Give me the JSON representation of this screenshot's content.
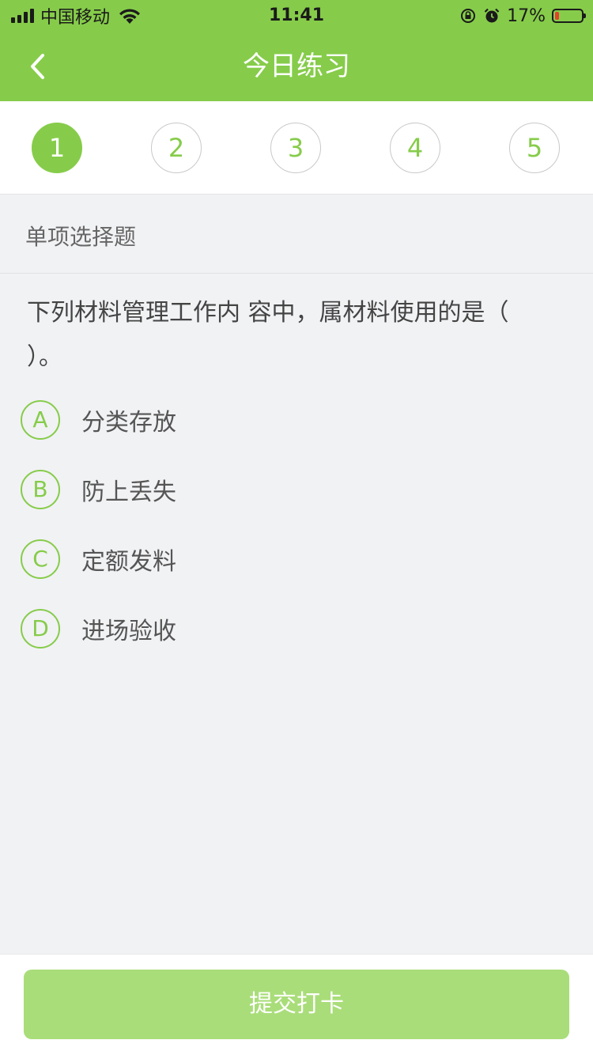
{
  "status_bar": {
    "carrier": "中国移动",
    "time": "11:41",
    "battery_percent": "17%",
    "battery_level": 0.17,
    "battery_color": "#e5402a",
    "icons": [
      "signal-icon",
      "wifi-icon",
      "rotation-lock-icon",
      "alarm-icon",
      "battery-icon"
    ]
  },
  "nav": {
    "title": "今日练习",
    "back_icon": "chevron-left-icon"
  },
  "steps": [
    {
      "label": "1",
      "active": true
    },
    {
      "label": "2",
      "active": false
    },
    {
      "label": "3",
      "active": false
    },
    {
      "label": "4",
      "active": false
    },
    {
      "label": "5",
      "active": false
    }
  ],
  "section": {
    "label": "单项选择题"
  },
  "question": {
    "text": "下列材料管理工作内 容中，属材料使用的是（   ）。"
  },
  "options": [
    {
      "letter": "A",
      "text": "分类存放"
    },
    {
      "letter": "B",
      "text": "防上丢失"
    },
    {
      "letter": "C",
      "text": "定额发料"
    },
    {
      "letter": "D",
      "text": "进场验收"
    }
  ],
  "submit": {
    "label": "提交打卡"
  },
  "colors": {
    "brand_green": "#86cc4a",
    "submit_green": "#a9dd79",
    "background": "#f1f2f4"
  }
}
